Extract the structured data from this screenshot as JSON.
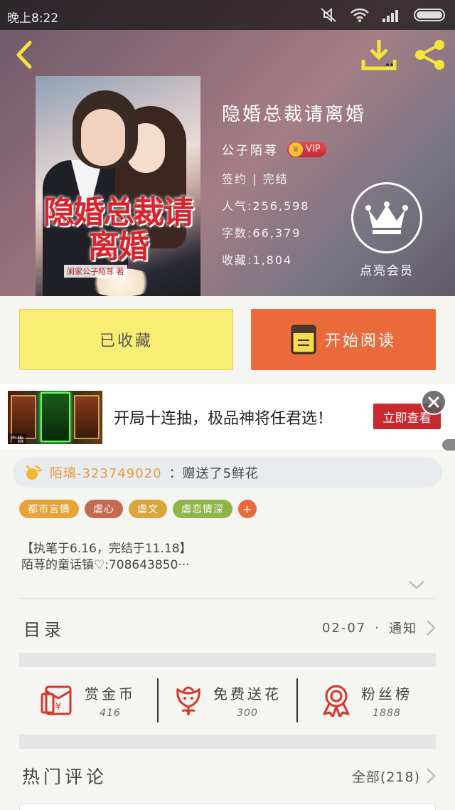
{
  "status_bar": {
    "time": "晚上8:22"
  },
  "book": {
    "title": "隐婚总裁请离婚",
    "author": "公子陌荨",
    "vip_label": "VIP",
    "status": "签约 | 完结",
    "popularity": "人气:256,598",
    "word_count": "字数:66,379",
    "favorites": "收藏:1,804",
    "cover_title": "隐婚总裁请离婚",
    "cover_author": "阑家公子陌荨 著"
  },
  "member": {
    "label": "点亮会员"
  },
  "actions": {
    "collect": "已收藏",
    "read": "开始阅读"
  },
  "ad": {
    "text": "开局十连抽，极品神将任君选！",
    "cta": "立即查看",
    "tag": "广告"
  },
  "gift": {
    "user": "陌璃-323749020",
    "message": "：赠送了5鲜花"
  },
  "tags": [
    {
      "label": "都市言情",
      "color": "#e8a23a"
    },
    {
      "label": "虐心",
      "color": "#c46a52"
    },
    {
      "label": "虐文",
      "color": "#d9a53c"
    },
    {
      "label": "虐恋情深",
      "color": "#8fb54a"
    },
    {
      "label": "+",
      "color": "#e86a3c"
    }
  ],
  "description": [
    "【执笔于6.16，完结于11.18】",
    "陌荨的童话镇♡:708643850···"
  ],
  "toc": {
    "label": "目录",
    "date": "02-07",
    "dot": "·",
    "notice": "通知"
  },
  "stats": [
    {
      "name": "赏金币",
      "value": "416"
    },
    {
      "name": "免费送花",
      "value": "300"
    },
    {
      "name": "粉丝榜",
      "value": "1888"
    }
  ],
  "hot_comments": {
    "label": "热门评论",
    "all": "全部(218)"
  },
  "colors": {
    "accent_orange": "#ea6a3c",
    "collect_yellow": "#f8ee74",
    "icon_red": "#d8352a",
    "ad_red": "#c8282e"
  }
}
